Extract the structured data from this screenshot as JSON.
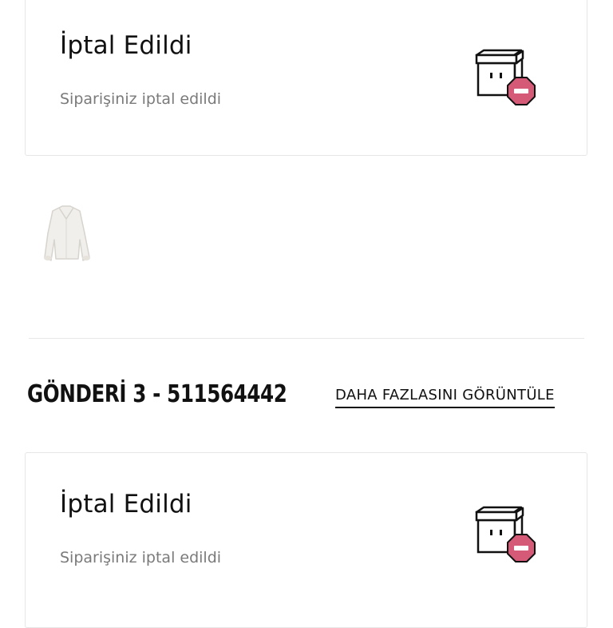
{
  "shipments": [
    {
      "status_title": "İptal Edildi",
      "status_subtitle": "Siparişiniz iptal edildi",
      "status_icon": "cancelled-box-icon"
    },
    {
      "status_title": "İptal Edildi",
      "status_subtitle": "Siparişiniz iptal edildi",
      "status_icon": "cancelled-box-icon"
    }
  ],
  "product": {
    "image": "white-fur-jacket-thumbnail"
  },
  "shipment_header": {
    "title": "GÖNDERİ 3 - 511564442",
    "more_link": "DAHA FAZLASINI GÖRÜNTÜLE"
  },
  "colors": {
    "cancel_badge": "#d45a77",
    "border": "#e6e6e6",
    "subtext": "#7a7a7a"
  }
}
